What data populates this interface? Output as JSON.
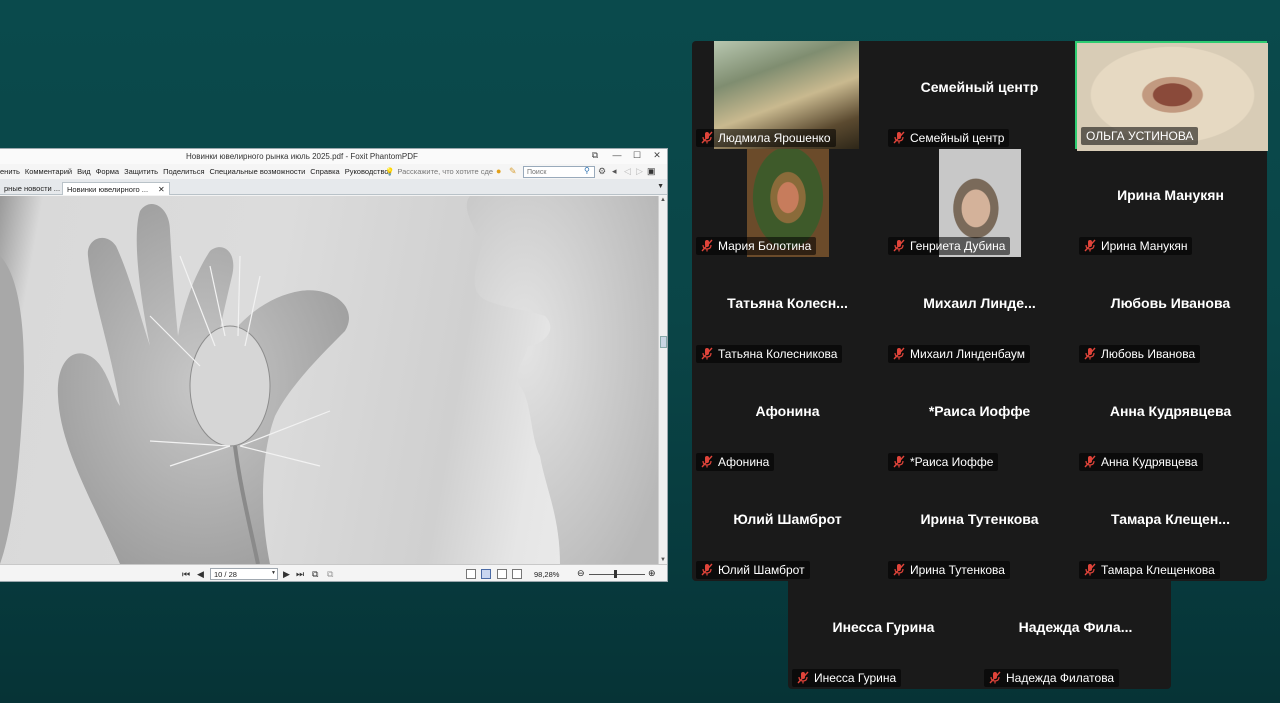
{
  "pdf_viewer": {
    "title": "Новинки ювелирного рынка июль 2025.pdf - Foxit PhantomPDF",
    "menu": [
      "енить",
      "Комментарий",
      "Вид",
      "Форма",
      "Защитить",
      "Поделиться",
      "Специальные возможности",
      "Справка",
      "Руководство"
    ],
    "tell_me_placeholder": "Расскажите, что хотите сде",
    "search_placeholder": "Поиск",
    "tabs": [
      {
        "label": "рные новости ...",
        "active": false
      },
      {
        "label": "Новинки ювелирного ...",
        "active": true
      }
    ],
    "page_indicator": "10 / 28",
    "zoom": "98,28%",
    "window_controls": {
      "restore": "⧉",
      "minimize": "—",
      "maximize": "☐",
      "close": "✕"
    }
  },
  "participants": [
    {
      "display": "",
      "label": "Людмила Ярошенко",
      "muted": true,
      "video": true
    },
    {
      "display": "Семейный центр",
      "label": "Семейный центр",
      "muted": true,
      "video": false
    },
    {
      "display": "",
      "label": "ОЛЬГА УСТИНОВА",
      "muted": false,
      "video": true,
      "active_speaker": true
    },
    {
      "display": "",
      "label": "Мария Болотина",
      "muted": true,
      "video": true
    },
    {
      "display": "",
      "label": "Генриета Дубина",
      "muted": true,
      "video": true
    },
    {
      "display": "Ирина Манукян",
      "label": "Ирина Манукян",
      "muted": true,
      "video": false
    },
    {
      "display": "Татьяна  Колесн...",
      "label": "Татьяна Колесникова",
      "muted": true,
      "video": false
    },
    {
      "display": "Михаил  Линде...",
      "label": "Михаил Линденбаум",
      "muted": true,
      "video": false
    },
    {
      "display": "Любовь Иванова",
      "label": "Любовь Иванова",
      "muted": true,
      "video": false
    },
    {
      "display": "Афонина",
      "label": "Афонина",
      "muted": true,
      "video": false
    },
    {
      "display": "*Раиса Иоффе",
      "label": "*Раиса Иоффе",
      "muted": true,
      "video": false
    },
    {
      "display": "Анна Кудрявцева",
      "label": "Анна Кудрявцева",
      "muted": true,
      "video": false
    },
    {
      "display": "Юлий Шамброт",
      "label": "Юлий Шамброт",
      "muted": true,
      "video": false
    },
    {
      "display": "Ирина Тутенкова",
      "label": "Ирина Тутенкова",
      "muted": true,
      "video": false
    },
    {
      "display": "Тамара  Клещен...",
      "label": "Тамара Клещенкова",
      "muted": true,
      "video": false
    },
    {
      "display": "Инесса Гурина",
      "label": "Инесса Гурина",
      "muted": true,
      "video": false
    },
    {
      "display": "Надежда  Фила...",
      "label": "Надежда Филатова",
      "muted": true,
      "video": false
    }
  ],
  "colors": {
    "desktop_bg": "#0a4a4c",
    "tile_bg": "#1a1a1a",
    "active_speaker_border": "#2ecc71",
    "mute_icon": "#e0443a"
  }
}
